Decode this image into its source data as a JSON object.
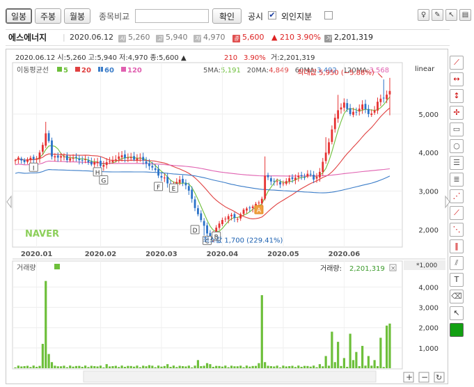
{
  "toolbar": {
    "day_label": "일봉",
    "week_label": "주봉",
    "month_label": "월봉",
    "compare_label": "종목비교",
    "confirm_label": "확인",
    "disclosure_label": "공시",
    "disclosure_check": "✔",
    "foreign_label": "외인지분"
  },
  "info": {
    "name": "에스에너지",
    "date": "2020.06.12",
    "open_badge": "시",
    "open": "5,260",
    "high_badge": "고",
    "high": "5,940",
    "low_badge": "저",
    "low": "4,970",
    "close_badge": "종",
    "close": "5,600",
    "change": "▲ 210",
    "rate": "3.90%",
    "vol_badge": "거",
    "volume": "2,201,319"
  },
  "chart_header": {
    "line": "2020.06.12 시:5,260 고:5,940 저:4,970 종:5,600 ▲",
    "change": "210",
    "rate": "3.90%",
    "volume": "거:2,201,319",
    "ma_title": "이동평균선",
    "scale": "linear",
    "watermark": "NAVER",
    "unit": "*1,000",
    "volume_title": "거래량",
    "volume_value_label": "거래량:",
    "volume_value": "2,201,319",
    "close_x": "×"
  },
  "colors": {
    "up": "#e63232",
    "down": "#2a72c8",
    "ma5": "#6dbf3a",
    "ma20": "#e04040",
    "ma60": "#3a7cc8",
    "ma120": "#e060b0",
    "volume": "#6dbf3a"
  },
  "chart_data": {
    "type": "candlestick",
    "ma_legend": [
      {
        "period": "5",
        "color": "#6dbf3a"
      },
      {
        "period": "20",
        "color": "#e04040"
      },
      {
        "period": "60",
        "color": "#3a7cc8"
      },
      {
        "period": "120",
        "color": "#e060b0"
      }
    ],
    "ma_values": [
      {
        "label": "5MA:",
        "value": "5,191"
      },
      {
        "label": "20MA:",
        "value": "4,849"
      },
      {
        "label": "60MA:",
        "value": "3,492"
      },
      {
        "label": "120MA:",
        "value": "3,568"
      }
    ],
    "max_label": "최대값 5,950 (−5.88%)",
    "min_label": "최소값 1,700 (229.41%)",
    "y_ticks": [
      2000,
      3000,
      4000,
      5000
    ],
    "y_tick_labels": [
      "2,000",
      "3,000",
      "4,000",
      "5,000"
    ],
    "ylim": [
      1600,
      6300
    ],
    "x_tick_labels": [
      "2020.01",
      "2020.02",
      "2020.03",
      "2020.04",
      "2020.05",
      "2020.06"
    ],
    "x_tick_index": [
      7,
      28,
      48,
      68,
      88,
      108
    ],
    "n_days": 124,
    "close_keys": [
      [
        0,
        3800
      ],
      [
        7,
        3850
      ],
      [
        8,
        4000
      ],
      [
        9,
        4200
      ],
      [
        10,
        4500
      ],
      [
        11,
        4300
      ],
      [
        12,
        3900
      ],
      [
        18,
        3850
      ],
      [
        26,
        3750
      ],
      [
        28,
        3650
      ],
      [
        30,
        3750
      ],
      [
        32,
        3800
      ],
      [
        34,
        3900
      ],
      [
        40,
        3850
      ],
      [
        42,
        3800
      ],
      [
        44,
        3650
      ],
      [
        46,
        3550
      ],
      [
        48,
        3350
      ],
      [
        50,
        3200
      ],
      [
        52,
        3150
      ],
      [
        54,
        3300
      ],
      [
        56,
        3150
      ],
      [
        58,
        2800
      ],
      [
        60,
        2400
      ],
      [
        62,
        2100
      ],
      [
        63,
        1900
      ],
      [
        64,
        1800
      ],
      [
        66,
        2050
      ],
      [
        68,
        2250
      ],
      [
        70,
        2350
      ],
      [
        72,
        2300
      ],
      [
        74,
        2400
      ],
      [
        76,
        2550
      ],
      [
        78,
        2600
      ],
      [
        80,
        2700
      ],
      [
        81,
        2800
      ],
      [
        82,
        3400
      ],
      [
        84,
        3250
      ],
      [
        88,
        3200
      ],
      [
        92,
        3350
      ],
      [
        96,
        3450
      ],
      [
        98,
        3300
      ],
      [
        100,
        3500
      ],
      [
        102,
        4000
      ],
      [
        104,
        4600
      ],
      [
        106,
        5100
      ],
      [
        108,
        5300
      ],
      [
        110,
        5000
      ],
      [
        112,
        5050
      ],
      [
        114,
        5250
      ],
      [
        116,
        5000
      ],
      [
        118,
        5100
      ],
      [
        120,
        5400
      ],
      [
        123,
        5600
      ]
    ],
    "high_overrides": [
      [
        10,
        4800
      ],
      [
        82,
        3900
      ],
      [
        102,
        4400
      ],
      [
        106,
        5500
      ],
      [
        121,
        5900
      ],
      [
        123,
        5940
      ]
    ],
    "low_overrides": [
      [
        63,
        1700
      ],
      [
        62,
        1850
      ],
      [
        123,
        4970
      ]
    ],
    "markers": [
      {
        "label": "I",
        "index": 6,
        "price": 3620
      },
      {
        "label": "H",
        "index": 27,
        "price": 3500
      },
      {
        "label": "G",
        "index": 29,
        "price": 3290
      },
      {
        "label": "F",
        "index": 47,
        "price": 3120
      },
      {
        "label": "E",
        "index": 52,
        "price": 3080
      },
      {
        "label": "D",
        "index": 59,
        "price": 2000
      },
      {
        "label": "C",
        "index": 63,
        "price": 1720
      },
      {
        "label": "B",
        "index": 66,
        "price": 1830
      },
      {
        "label": "A",
        "index": 80,
        "price": 2520
      }
    ],
    "volume_ticks": [
      1000,
      2000,
      3000,
      4000
    ],
    "volume_tick_labels": [
      "1,000",
      "2,000",
      "3,000",
      "4,000"
    ],
    "volume_ylim": [
      0,
      4700
    ],
    "volume_spikes": [
      [
        9,
        1200
      ],
      [
        10,
        4300
      ],
      [
        11,
        700
      ],
      [
        12,
        300
      ],
      [
        30,
        200
      ],
      [
        44,
        150
      ],
      [
        50,
        200
      ],
      [
        60,
        400
      ],
      [
        63,
        250
      ],
      [
        64,
        200
      ],
      [
        80,
        250
      ],
      [
        81,
        3600
      ],
      [
        82,
        300
      ],
      [
        100,
        200
      ],
      [
        102,
        600
      ],
      [
        104,
        1800
      ],
      [
        105,
        300
      ],
      [
        106,
        1300
      ],
      [
        108,
        500
      ],
      [
        110,
        1700
      ],
      [
        111,
        400
      ],
      [
        112,
        800
      ],
      [
        114,
        1100
      ],
      [
        116,
        600
      ],
      [
        118,
        400
      ],
      [
        120,
        1500
      ],
      [
        122,
        2100
      ],
      [
        123,
        2200
      ]
    ]
  }
}
